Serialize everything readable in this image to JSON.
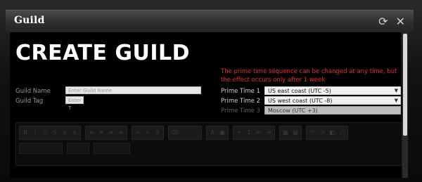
{
  "window": {
    "title": "Guild",
    "icons": [
      "refresh-icon",
      "close-icon"
    ]
  },
  "main": {
    "heading": "CREATE GUILD",
    "notice": "The prime time sequence can be changed at any time, but the effect occurs only after 1 week",
    "guild_name": {
      "label": "Guild Name",
      "placeholder": "Enter Guild Name",
      "value": ""
    },
    "guild_tag": {
      "label": "Guild Tag",
      "placeholder": "Enter T",
      "value": ""
    },
    "prime_times": [
      {
        "label": "Prime Time 1",
        "value": "US east coast (UTC -5)",
        "enabled": true
      },
      {
        "label": "Prime Time 2",
        "value": "US west coast (UTC -8)",
        "enabled": true
      },
      {
        "label": "Prime Time 3",
        "value": "Moscow (UTC +3)",
        "enabled": false
      }
    ]
  },
  "colors": {
    "notice": "#e0302a",
    "background": "#000000",
    "title_bar": "#333333"
  }
}
